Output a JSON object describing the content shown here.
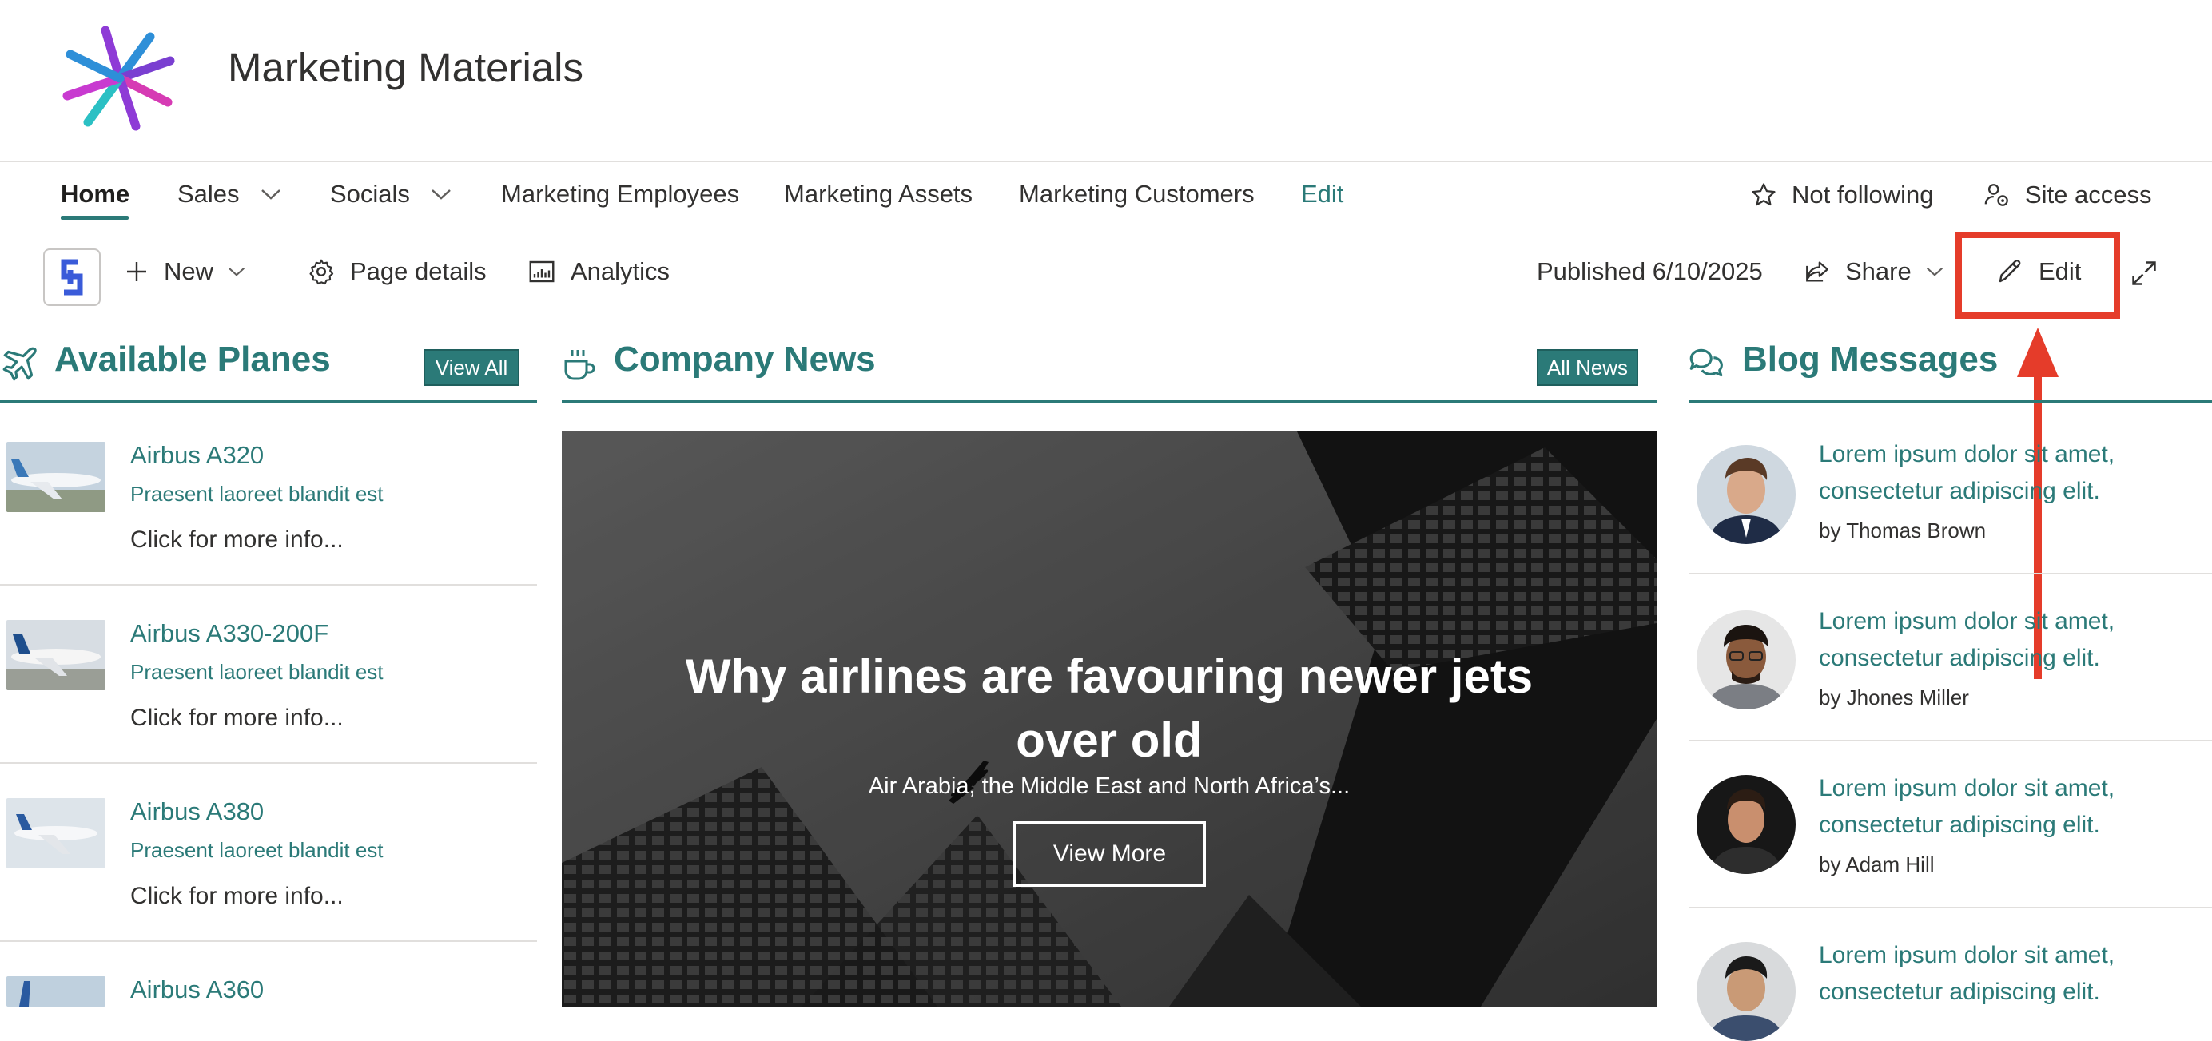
{
  "site": {
    "title": "Marketing Materials"
  },
  "nav": {
    "items": [
      {
        "label": "Home"
      },
      {
        "label": "Sales"
      },
      {
        "label": "Socials"
      },
      {
        "label": "Marketing Employees"
      },
      {
        "label": "Marketing Assets"
      },
      {
        "label": "Marketing Customers"
      },
      {
        "label": "Edit"
      }
    ],
    "follow_label": "Not following",
    "site_access_label": "Site access"
  },
  "commandbar": {
    "new_label": "New",
    "page_details_label": "Page details",
    "analytics_label": "Analytics",
    "published": "Published 6/10/2025",
    "share_label": "Share",
    "edit_label": "Edit"
  },
  "planes": {
    "title": "Available Planes",
    "view_all": "View All",
    "items": [
      {
        "name": "Airbus A320",
        "desc": "Praesent laoreet blandit est",
        "more": "Click for more info..."
      },
      {
        "name": "Airbus A330-200F",
        "desc": "Praesent laoreet blandit est",
        "more": "Click for more info..."
      },
      {
        "name": "Airbus A380",
        "desc": "Praesent laoreet blandit est",
        "more": "Click for more info..."
      },
      {
        "name": "Airbus A360"
      }
    ]
  },
  "news": {
    "title": "Company News",
    "all_news": "All News",
    "headline": "Why airlines are favouring newer jets over old",
    "summary": "Air Arabia, the Middle East and North Africa’s...",
    "view_more": "View More"
  },
  "blog": {
    "title": "Blog Messages",
    "items": [
      {
        "text": "Lorem ipsum dolor sit amet, consectetur adipiscing elit.",
        "author": "by Thomas Brown"
      },
      {
        "text": "Lorem ipsum dolor sit amet, consectetur adipiscing elit.",
        "author": "by Jhones Miller"
      },
      {
        "text": "Lorem ipsum dolor sit amet, consectetur adipiscing elit.",
        "author": "by Adam Hill"
      },
      {
        "text": "Lorem ipsum dolor sit amet, consectetur adipiscing elit."
      }
    ]
  },
  "colors": {
    "accent": "#2b7a78",
    "highlight": "#e53c2a"
  }
}
